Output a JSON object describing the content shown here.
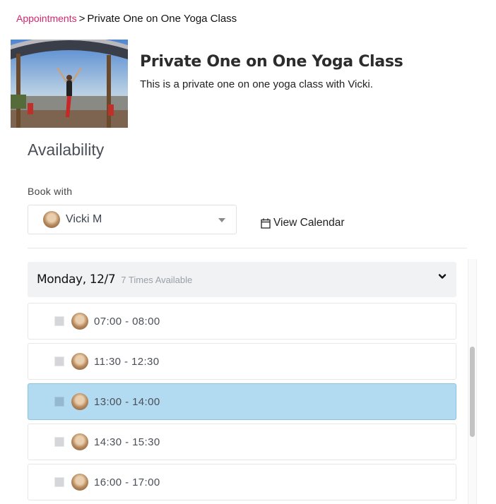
{
  "breadcrumb": {
    "parent": "Appointments",
    "separator": ">",
    "current": "Private One on One Yoga Class"
  },
  "class": {
    "title": "Private One on One Yoga Class",
    "description": "This is a private one on one yoga class with Vicki.",
    "image_alt": "yoga pose under pergola"
  },
  "availability": {
    "heading": "Availability",
    "book_with_label": "Book with",
    "selected_staff": "Vicki M",
    "view_calendar_label": "View Calendar"
  },
  "day_group": {
    "label": "Monday, 12/7",
    "count_label": "7 Times Available",
    "expanded": true
  },
  "slots": [
    {
      "time": "07:00 - 08:00",
      "selected": false
    },
    {
      "time": "11:30 - 12:30",
      "selected": false
    },
    {
      "time": "13:00 - 14:00",
      "selected": true
    },
    {
      "time": "14:30 - 15:30",
      "selected": false
    },
    {
      "time": "16:00 - 17:00",
      "selected": false
    }
  ],
  "colors": {
    "accent_link": "#d6266e",
    "selected_slot": "#b2daf0",
    "day_header_bg": "#f1f2f4"
  }
}
